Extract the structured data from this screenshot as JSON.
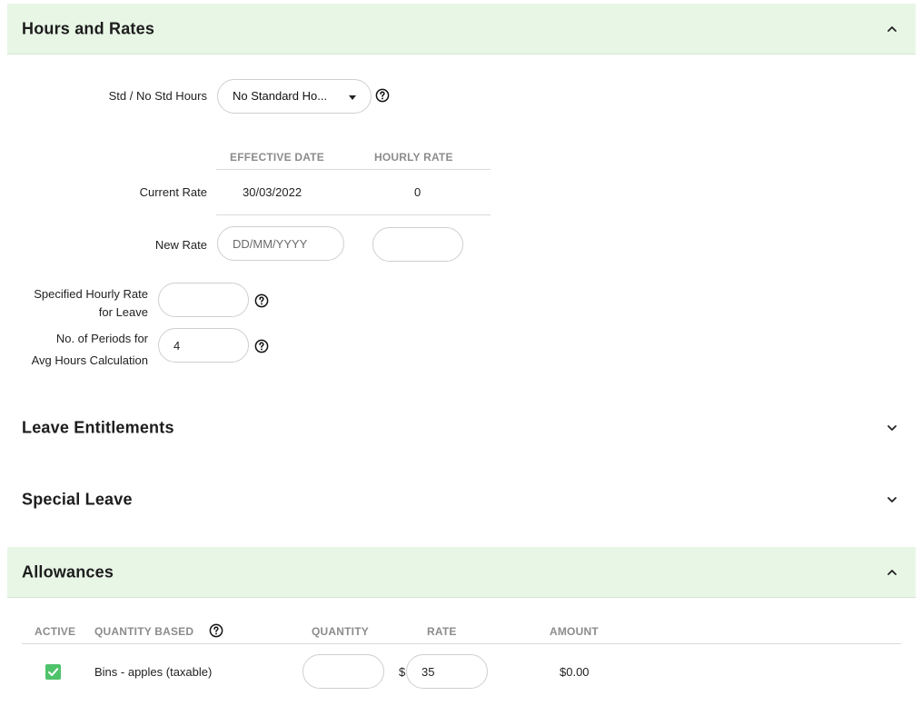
{
  "hours_rates": {
    "title": "Hours and Rates",
    "std_hours": {
      "label": "Std / No Std Hours",
      "selected": "No Standard Ho..."
    },
    "columns": {
      "effective_date": "EFFECTIVE DATE",
      "hourly_rate": "HOURLY RATE"
    },
    "current_rate": {
      "label": "Current Rate",
      "date": "30/03/2022",
      "rate": "0"
    },
    "new_rate": {
      "label": "New Rate",
      "date_placeholder": "DD/MM/YYYY",
      "rate_value": ""
    },
    "specified_rate": {
      "label_line1": "Specified Hourly Rate",
      "label_line2": "for Leave",
      "value": ""
    },
    "periods": {
      "label_line1": "No. of Periods for",
      "label_line2": "Avg Hours Calculation",
      "value": "4"
    }
  },
  "leave_entitlements": {
    "title": "Leave Entitlements"
  },
  "special_leave": {
    "title": "Special Leave"
  },
  "allowances": {
    "title": "Allowances",
    "columns": {
      "active": "ACTIVE",
      "quantity_based": "QUANTITY BASED",
      "quantity": "QUANTITY",
      "rate": "RATE",
      "amount": "AMOUNT"
    },
    "rows": [
      {
        "active": true,
        "name": "Bins - apples (taxable)",
        "quantity": "",
        "currency": "$",
        "rate": "35",
        "amount": "$0.00"
      }
    ]
  },
  "icons": {
    "expanded": "chevron-up-icon",
    "collapsed": "chevron-down-icon",
    "help": "question-circle-icon",
    "check": "check-icon"
  },
  "colors": {
    "header_bg": "#e8f6e6",
    "check_green": "#4fc36b"
  }
}
